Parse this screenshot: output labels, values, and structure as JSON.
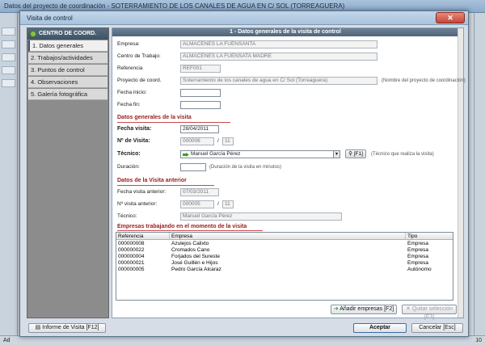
{
  "parent_window": {
    "title": "Datos del proyecto de coordinación -  SOTERRAMIENTO DE LOS CANALES DE AGUA EN C/ SOL (TORREAGUERA)",
    "status_left": "Ad",
    "status_right": "10"
  },
  "dialog": {
    "title": "Visita de control",
    "close_glyph": "✕"
  },
  "nav": {
    "header": "CENTRO DE COORD.",
    "items": [
      {
        "label": "1. Datos generales"
      },
      {
        "label": "2. Trabajos/actividades"
      },
      {
        "label": "3. Puntos de control"
      },
      {
        "label": "4. Observaciones"
      },
      {
        "label": "5. Galería fotográfica"
      }
    ]
  },
  "section_title": "1 - Datos generales de la visita de control",
  "general": {
    "empresa_label": "Empresa:",
    "empresa_value": "ALMACENES LA FUENSANTA",
    "centro_label": "Centro de Trabajo:",
    "centro_value": "ALMACENES LA FUENSATA MADRE",
    "referencia_label": "Referencia",
    "referencia_value": "REF001",
    "proyecto_label": "Proyecto de coord.",
    "proyecto_value": "Soterramiento de los canales de agua en C/ Sol (Torreaguera)",
    "proyecto_hint": "(Nombre del proyecto de coordinación)",
    "fecha_inicio_label": "Fecha inicio:",
    "fecha_inicio_value": "",
    "fecha_fin_label": "Fecha fin:",
    "fecha_fin_value": ""
  },
  "visita": {
    "section": "Datos generales de la visita",
    "fecha_label": "Fecha visita:",
    "fecha_value": "28/04/2011",
    "num_label": "Nº de Visita:",
    "num_value": "000006",
    "num_sep": "/",
    "num_total": "11",
    "tecnico_label": "Técnico:",
    "tecnico_value": "Manuel García Pérez",
    "tecnico_btn": "[F1]",
    "tecnico_hint": "(Técnico que realiza la visita)",
    "duracion_label": "Duración:",
    "duracion_value": "",
    "duracion_hint": "(Duración de la visita en minutos)"
  },
  "anterior": {
    "section": "Datos de la Visita anterior",
    "fecha_label": "Fecha visita anterior:",
    "fecha_value": "07/03/2011",
    "num_label": "Nº visita anterior:",
    "num_value": "000005",
    "num_sep": "/",
    "num_total": "11",
    "tecnico_label": "Técnico:",
    "tecnico_value": "Manuel García Pérez"
  },
  "empresas": {
    "section": "Empresas trabajando en el momento de la visita",
    "columns": [
      "Referencia",
      "Empresa",
      "Tipo"
    ],
    "rows": [
      [
        "000000008",
        "Azulejos Calixto",
        "Empresa"
      ],
      [
        "000000022",
        "Cromados Cano",
        "Empresa"
      ],
      [
        "000000004",
        "Forjados del Sureste",
        "Empresa"
      ],
      [
        "000000021",
        "José Guillén e Hijos",
        "Empresa"
      ],
      [
        "000000005",
        "Pedro García Alcaraz",
        "Autónomo"
      ]
    ],
    "add_btn": "Añadir empresas  [F2]",
    "remove_btn": "Quitar selección  [F3]"
  },
  "footer": {
    "informe_btn": "Informe de Visita  [F12]",
    "aceptar_btn": "Aceptar",
    "cancelar_btn": "Cancelar  [Esc]"
  }
}
